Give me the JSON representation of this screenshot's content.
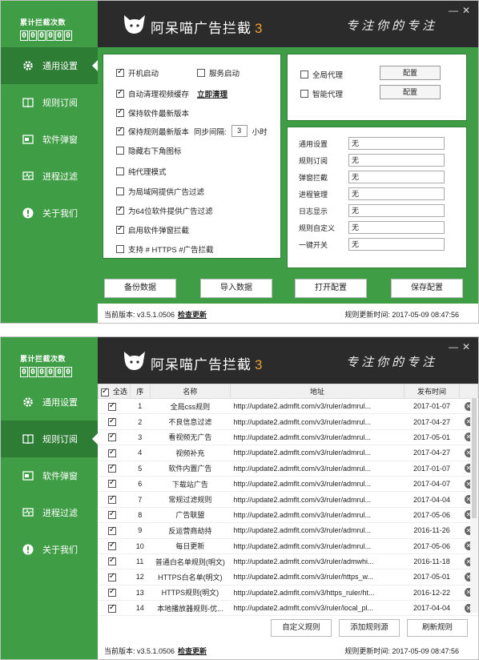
{
  "counter": {
    "label": "累计拦截次数",
    "digits": [
      "0",
      "0",
      "0",
      "0",
      "0",
      "0"
    ]
  },
  "header": {
    "app_name": "阿呆喵广告拦截",
    "version_mark": "3",
    "slogan": "专注你的专注",
    "min_label": "—",
    "close_label": "✕"
  },
  "nav": [
    {
      "label": "通用设置",
      "icon": "gear-icon"
    },
    {
      "label": "规则订阅",
      "icon": "book-icon"
    },
    {
      "label": "软件弹窗",
      "icon": "popup-window-icon"
    },
    {
      "label": "进程过滤",
      "icon": "process-monitor-icon"
    },
    {
      "label": "关于我们",
      "icon": "info-icon"
    }
  ],
  "general": {
    "options": [
      {
        "label": "开机启动",
        "checked": true
      },
      {
        "label": "服务启动",
        "checked": false
      },
      {
        "label": "自动清理视频缓存",
        "checked": true
      },
      {
        "label": "保持软件最新版本",
        "checked": true
      },
      {
        "label": "保持规则最新版本",
        "checked": true
      },
      {
        "label": "隐藏右下角图标",
        "checked": false
      },
      {
        "label": "纯代理模式",
        "checked": false
      },
      {
        "label": "为局域网提供广告过滤",
        "checked": false
      },
      {
        "label": "为64位软件提供广告过滤",
        "checked": true
      },
      {
        "label": "启用软件弹窗拦截",
        "checked": true
      },
      {
        "label": "支持 # HTTPS #广告拦截",
        "checked": false
      }
    ],
    "clean_now": "立即清理",
    "sync_interval_label": "同步间隔:",
    "sync_interval_value": "3",
    "sync_interval_unit": "小时",
    "proxy": [
      {
        "label": "全局代理",
        "checked": false,
        "button": "配置"
      },
      {
        "label": "智能代理",
        "checked": false,
        "button": "配置"
      }
    ],
    "shortcuts": [
      {
        "label": "通用设置",
        "value": "无"
      },
      {
        "label": "规则订阅",
        "value": "无"
      },
      {
        "label": "弹窗拦截",
        "value": "无"
      },
      {
        "label": "进程管理",
        "value": "无"
      },
      {
        "label": "日志显示",
        "value": "无"
      },
      {
        "label": "规则自定义",
        "value": "无"
      },
      {
        "label": "一键开关",
        "value": "无"
      }
    ],
    "buttons": {
      "backup": "备份数据",
      "import": "导入数据",
      "open_config": "打开配置",
      "save_config": "保存配置"
    }
  },
  "footer": {
    "version": "当前版本: v3.5.1.0506",
    "check_update": "检查更新",
    "rule_time": "规则更新时间: 2017-05-09 08:47:56"
  },
  "rules": {
    "columns": {
      "select_all": "全选",
      "seq": "序",
      "name": "名称",
      "url": "地址",
      "date": "发布时间"
    },
    "rows": [
      {
        "seq": "1",
        "name": "全局css规则",
        "url": "http://update2.admflt.com/v3/ruler/admrul...",
        "date": "2017-01-07"
      },
      {
        "seq": "2",
        "name": "不良信息过滤",
        "url": "http://update2.admflt.com/v3/ruler/admrul...",
        "date": "2017-04-27"
      },
      {
        "seq": "3",
        "name": "看视频无广告",
        "url": "http://update2.admflt.com/v3/ruler/admrul...",
        "date": "2017-05-01"
      },
      {
        "seq": "4",
        "name": "视频补充",
        "url": "http://update2.admflt.com/v3/ruler/admrul...",
        "date": "2017-04-27"
      },
      {
        "seq": "5",
        "name": "软件内置广告",
        "url": "http://update2.admflt.com/v3/ruler/admrul...",
        "date": "2017-01-07"
      },
      {
        "seq": "6",
        "name": "下载站广告",
        "url": "http://update2.admflt.com/v3/ruler/admrul...",
        "date": "2017-04-07"
      },
      {
        "seq": "7",
        "name": "常规过滤规则",
        "url": "http://update2.admflt.com/v3/ruler/admrul...",
        "date": "2017-04-04"
      },
      {
        "seq": "8",
        "name": "广告联盟",
        "url": "http://update2.admflt.com/v3/ruler/admrul...",
        "date": "2017-05-06"
      },
      {
        "seq": "9",
        "name": "反运营商劫持",
        "url": "http://update2.admflt.com/v3/ruler/admrul...",
        "date": "2016-11-26"
      },
      {
        "seq": "10",
        "name": "每日更新",
        "url": "http://update2.admflt.com/v3/ruler/admrul...",
        "date": "2017-05-06"
      },
      {
        "seq": "11",
        "name": "普通白名单规则(明文)",
        "url": "http://update2.admflt.com/v3/ruler/admwhi...",
        "date": "2016-11-18"
      },
      {
        "seq": "12",
        "name": "HTTPS白名单(明文)",
        "url": "http://update2.admflt.com/v3/ruler/https_w...",
        "date": "2017-05-01"
      },
      {
        "seq": "13",
        "name": "HTTPS规则(明文)",
        "url": "http://update2.admflt.com/v3/https_ruler/ht...",
        "date": "2016-12-22"
      },
      {
        "seq": "14",
        "name": "本地播放器规则-优...",
        "url": "http://update2.admflt.com/v3/ruler/local_pl...",
        "date": "2017-04-04"
      }
    ],
    "buttons": {
      "custom": "自定义规则",
      "add_source": "添加规则源",
      "refresh": "刷新规则"
    }
  },
  "colors": {
    "sidebar": "#3f9e45",
    "sidebar_active": "#2e7d34",
    "header": "#2b2b2b",
    "version_accent": "#f0a030"
  }
}
